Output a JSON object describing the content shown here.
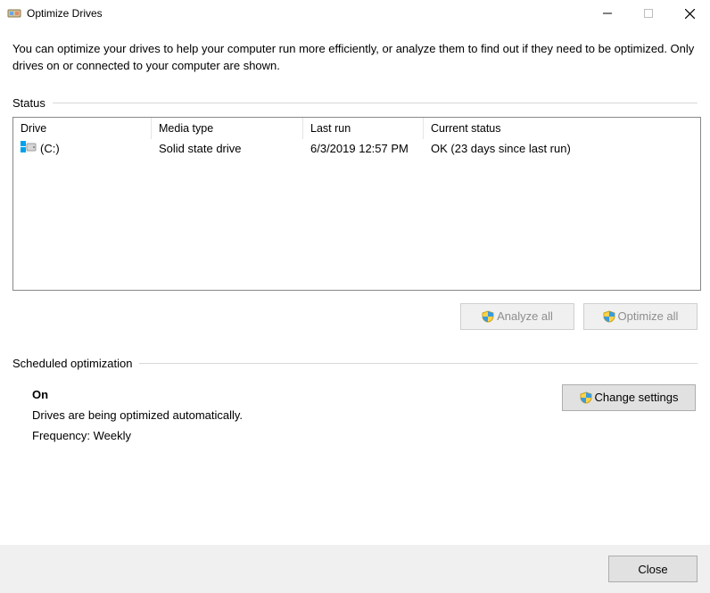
{
  "window": {
    "title": "Optimize Drives"
  },
  "intro": "You can optimize your drives to help your computer run more efficiently, or analyze them to find out if they need to be optimized. Only drives on or connected to your computer are shown.",
  "status_section_label": "Status",
  "columns": {
    "drive": "Drive",
    "media": "Media type",
    "lastrun": "Last run",
    "status": "Current status"
  },
  "drives": [
    {
      "name": "(C:)",
      "media": "Solid state drive",
      "lastrun": "6/3/2019 12:57 PM",
      "status": "OK (23 days since last run)"
    }
  ],
  "buttons": {
    "analyze": "Analyze all",
    "optimize": "Optimize all",
    "change": "Change settings",
    "close": "Close"
  },
  "sched": {
    "section_label": "Scheduled optimization",
    "state": "On",
    "desc": "Drives are being optimized automatically.",
    "freq": "Frequency: Weekly"
  }
}
